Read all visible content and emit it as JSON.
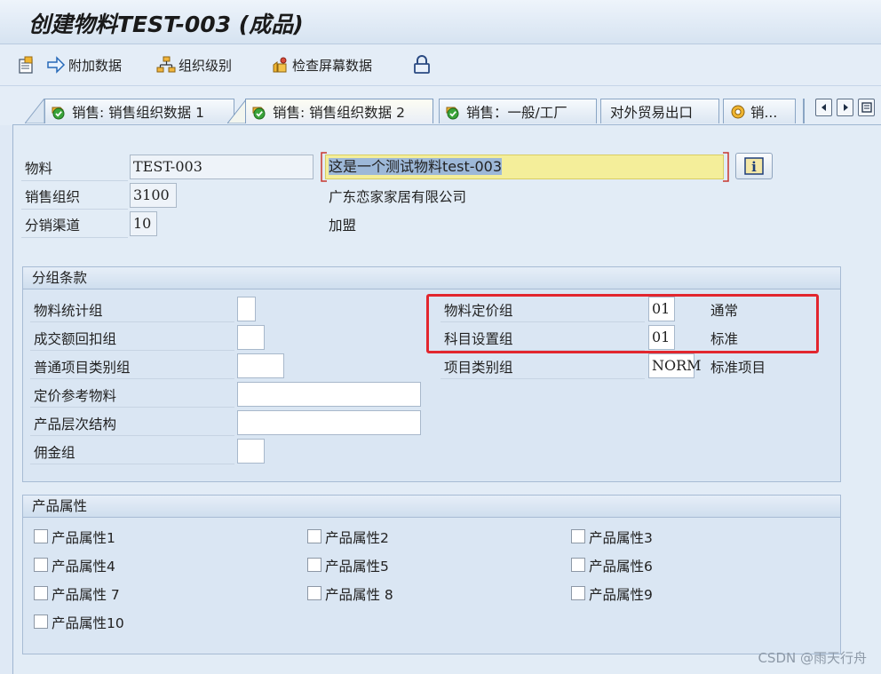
{
  "window": {
    "title": "创建物料TEST-003 (成品)"
  },
  "toolbar": {
    "additional_data": "附加数据",
    "org_levels": "组织级别",
    "check_screen_data": "检查屏幕数据"
  },
  "tabs": [
    {
      "label": "销售: 销售组织数据 1",
      "icon": "check-icon"
    },
    {
      "label": "销售: 销售组织数据 2",
      "icon": "check-icon",
      "active": true
    },
    {
      "label": "销售：一般/工厂",
      "icon": "check-icon"
    },
    {
      "label": "对外贸易出口"
    },
    {
      "label": "销...",
      "icon": "settings-icon"
    }
  ],
  "header": {
    "material_label": "物料",
    "material_value": "TEST-003",
    "material_desc": "这是一个测试物料test-003",
    "sales_org_label": "销售组织",
    "sales_org_value": "3100",
    "sales_org_desc": "广东恋家家居有限公司",
    "dist_channel_label": "分销渠道",
    "dist_channel_value": "10",
    "dist_channel_desc": "加盟"
  },
  "grouping": {
    "title": "分组条款",
    "left": [
      {
        "label": "物料统计组",
        "value": ""
      },
      {
        "label": "成交额回扣组",
        "value": ""
      },
      {
        "label": "普通项目类别组",
        "value": ""
      },
      {
        "label": "定价参考物料",
        "value": ""
      },
      {
        "label": "产品层次结构",
        "value": ""
      },
      {
        "label": "佣金组",
        "value": ""
      }
    ],
    "right": [
      {
        "label": "物料定价组",
        "value": "01",
        "desc": "通常"
      },
      {
        "label": "科目设置组",
        "value": "01",
        "desc": "标准"
      },
      {
        "label": "项目类别组",
        "value": "NORM",
        "desc": "标准项目"
      }
    ]
  },
  "attributes": {
    "title": "产品属性",
    "items": [
      {
        "label": "产品属性1",
        "checked": false
      },
      {
        "label": "产品属性2",
        "checked": false
      },
      {
        "label": "产品属性3",
        "checked": false
      },
      {
        "label": "产品属性4",
        "checked": false
      },
      {
        "label": "产品属性5",
        "checked": false
      },
      {
        "label": "产品属性6",
        "checked": false
      },
      {
        "label": "产品属性 7",
        "checked": false
      },
      {
        "label": "产品属性 8",
        "checked": false
      },
      {
        "label": "产品属性9",
        "checked": false
      },
      {
        "label": "产品属性10",
        "checked": false
      }
    ]
  },
  "watermark": "CSDN @雨天行舟",
  "colors": {
    "highlight": "#e2262e",
    "desc_field_bg": "#f4ee9a",
    "selection": "#9db8d8"
  }
}
